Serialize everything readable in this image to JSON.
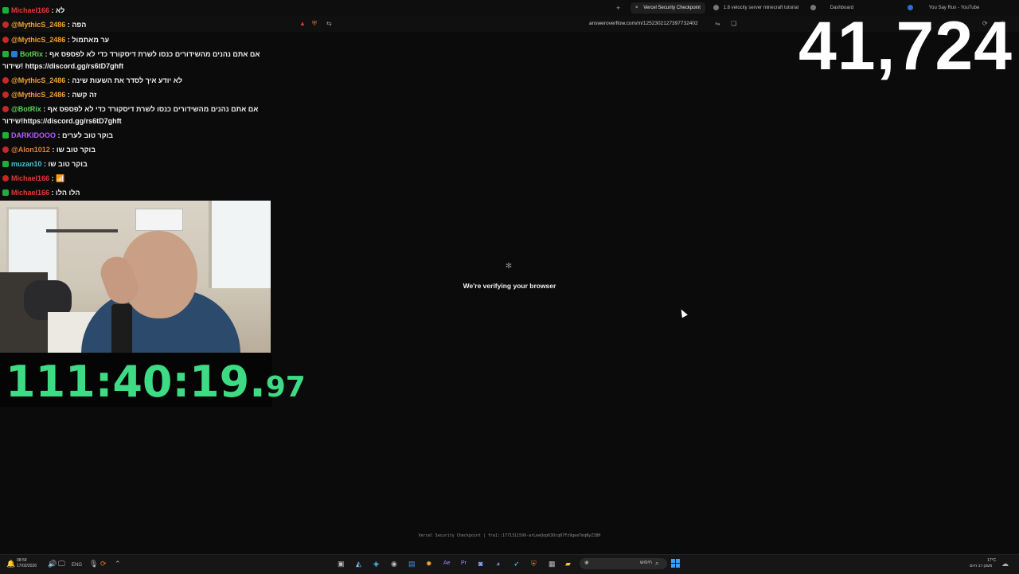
{
  "browser": {
    "tabs": [
      {
        "label": "Vercel Security Checkpoint",
        "active": true
      },
      {
        "label": "1.8 velocity server minecraft tutorial",
        "active": false
      },
      {
        "label": "Dashboard",
        "active": false
      },
      {
        "label": "You Say Run - YouTube",
        "active": false
      }
    ],
    "new_tab_symbol": "+",
    "close_symbol": "×",
    "url": "answeroverflow.com/m/1252302127397732402"
  },
  "chat": [
    {
      "user": "Michael166",
      "user_color": "#e53935",
      "badge": "red",
      "text": ": לא"
    },
    {
      "user": "@MythicS_2486",
      "user_color": "#f0a030",
      "badge": "red",
      "text": ": הפה"
    },
    {
      "user": "@MythicS_2486",
      "user_color": "#f0a030",
      "badge": "red",
      "text": ": ער מאתמול"
    },
    {
      "user": "BotRix",
      "user_color": "#5ad35a",
      "badge": "green",
      "text": ": אם אתם נהנים מהשידורים כנסו לשרת דיסקורד כדי לא לפספס אף",
      "cont": "שידור! https://discord.gg/rs6tD7ghft"
    },
    {
      "user": "@MythicS_2486",
      "user_color": "#f0a030",
      "badge": "red",
      "text": ": לא יודע איך לסדר את השעות שינה"
    },
    {
      "user": "@MythicS_2486",
      "user_color": "#f0a030",
      "badge": "red",
      "text": ": זה קשה"
    },
    {
      "user": "@BotRix",
      "user_color": "#5ad35a",
      "badge": "red",
      "text": ": אם אתם נהנים מהשידורים כנסו לשרת דיסקורד כדי לא לפספס אף",
      "cont": "שידור!https://discord.gg/rs6tD7ghft"
    },
    {
      "user": "DARKIDOOO",
      "user_color": "#b35cff",
      "badge": "green",
      "text": ": בוקר טוב לערים"
    },
    {
      "user": "@Alon1012",
      "user_color": "#e0803a",
      "badge": "red",
      "text": ": בוקר טוב שו"
    },
    {
      "user": "muzan10",
      "user_color": "#4fc3d9",
      "badge": "green",
      "text": ": בוקר טוב שו"
    },
    {
      "user": "Michael166",
      "user_color": "#e53935",
      "badge": "red",
      "text": ": 📶"
    },
    {
      "user": "Michael166",
      "user_color": "#e53935",
      "badge": "green",
      "text": ": הלו הלו"
    }
  ],
  "timer": {
    "main": "111:40:19.",
    "fraction": "97"
  },
  "counter": "41,724",
  "page": {
    "heading": "We're verifying your browser",
    "footer": "Vercel Security Checkpoint | fra1::1771311599-arLeeQop63Ocq07Fz9geeTmqNyZ38H"
  },
  "taskbar": {
    "search_placeholder": "חיפוש",
    "lang": "ENG",
    "time": "08:59",
    "date": "17/02/2026",
    "weather_temp": "17°C",
    "weather_text": "מעונן רב היום"
  },
  "colors": {
    "timer": "#3ddc84",
    "accent": "#3aa0ff"
  }
}
